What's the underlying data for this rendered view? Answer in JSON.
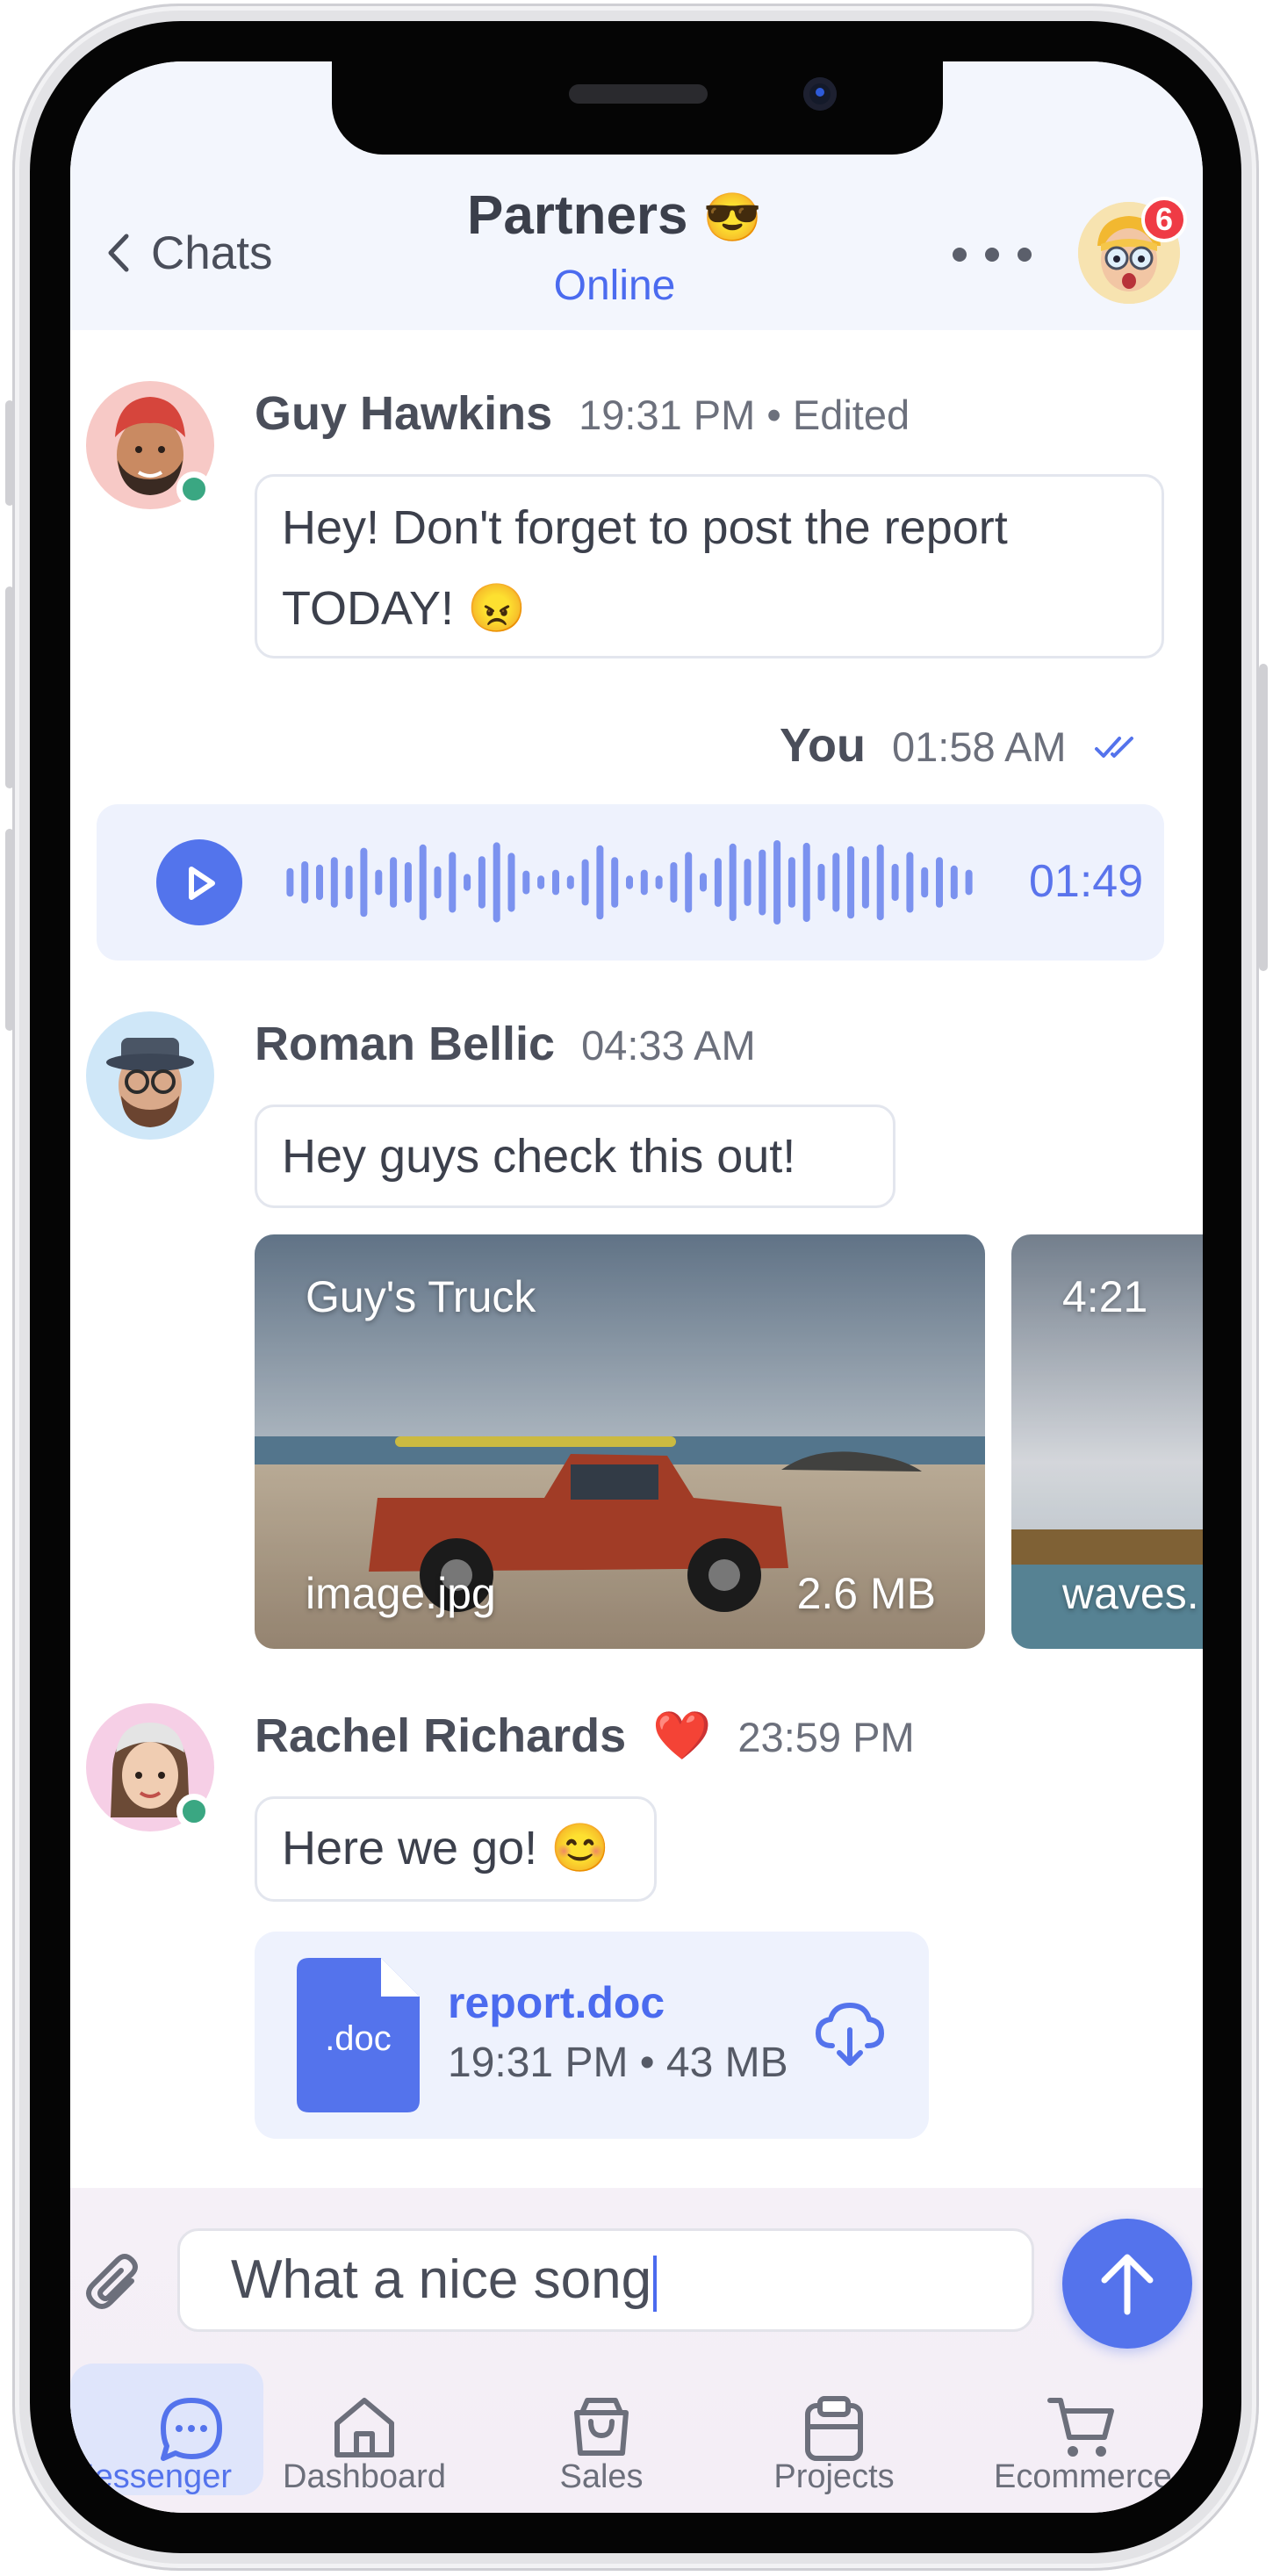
{
  "header": {
    "back_label": "Chats",
    "title": "Partners",
    "title_emoji": "😎",
    "status": "Online",
    "notification_count": "6"
  },
  "messages": [
    {
      "sender": "Guy Hawkins",
      "time": "19:31 PM • Edited",
      "text_line1": "Hey! Don't forget to post the report",
      "text_line2": "TODAY!",
      "emoji": "😠",
      "online": true
    },
    {
      "sender": "You",
      "time": "01:58 AM",
      "voice_duration": "01:49",
      "read_receipt": "double-check-icon"
    },
    {
      "sender": "Roman Bellic",
      "time": "04:33 AM",
      "text": "Hey guys check this out!",
      "media": [
        {
          "title": "Guy's Truck",
          "filename": "image.jpg",
          "size": "2.6 MB"
        },
        {
          "title": "4:21",
          "filename": "waves."
        }
      ]
    },
    {
      "sender": "Rachel Richards",
      "reaction": "❤️",
      "time": "23:59 PM",
      "text": "Here we go!",
      "emoji": "😊",
      "online": true,
      "file": {
        "ext": ".doc",
        "name": "report.doc",
        "info": "19:31 PM • 43 MB"
      }
    }
  ],
  "composer": {
    "input_value": "What a nice song"
  },
  "tabs": [
    {
      "label": "Messenger",
      "icon": "chat-bubble-icon",
      "active": true
    },
    {
      "label": "Dashboard",
      "icon": "home-icon",
      "active": false
    },
    {
      "label": "Sales",
      "icon": "shopping-bag-icon",
      "active": false
    },
    {
      "label": "Projects",
      "icon": "clipboard-icon",
      "active": false
    },
    {
      "label": "Ecommerce",
      "icon": "cart-icon",
      "active": false
    }
  ],
  "colors": {
    "accent": "#5473ec",
    "online": "#3aa782",
    "badge": "#ef3b45"
  }
}
